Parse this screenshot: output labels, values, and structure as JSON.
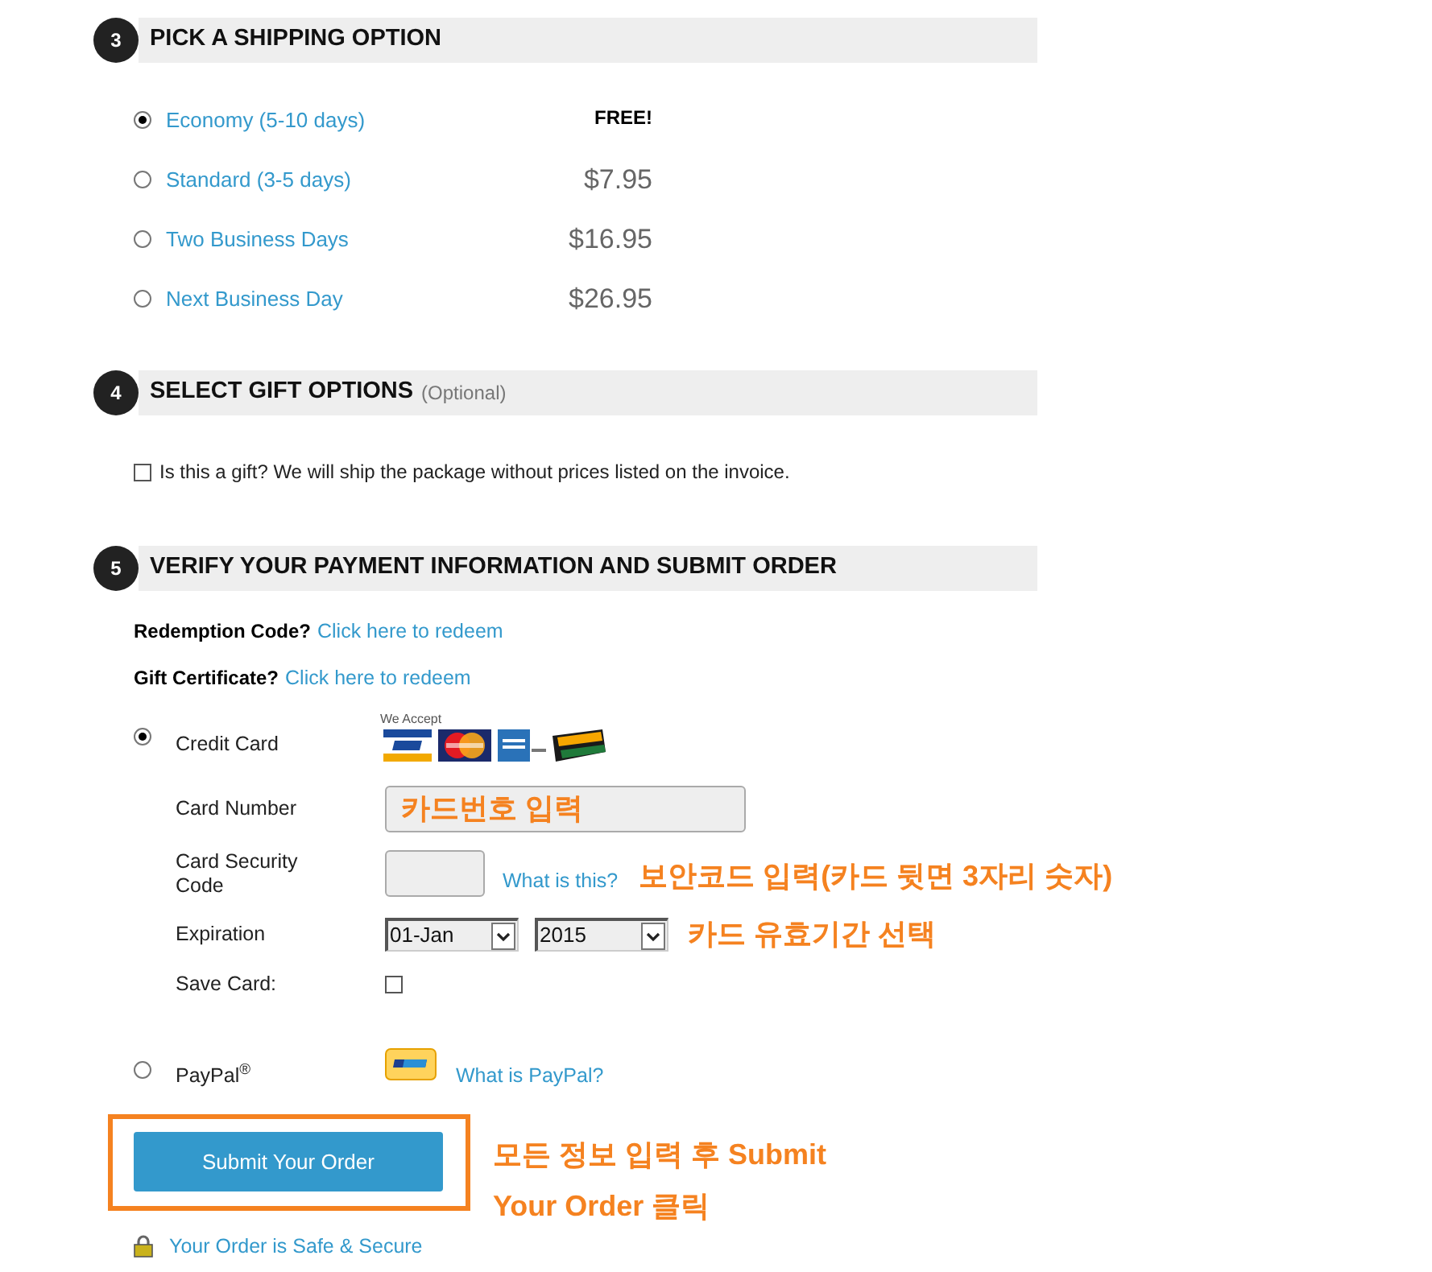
{
  "shipping_section": {
    "number": "3",
    "title": "PICK A SHIPPING OPTION",
    "options": [
      {
        "label": "Economy (5-10 days)",
        "price": "FREE!",
        "kind": "free",
        "selected": true
      },
      {
        "label": "Standard (3-5 days)",
        "price": "$7.95",
        "kind": "paid",
        "selected": false
      },
      {
        "label": "Two Business Days",
        "price": "$16.95",
        "kind": "paid",
        "selected": false
      },
      {
        "label": "Next Business Day",
        "price": "$26.95",
        "kind": "paid",
        "selected": false
      }
    ]
  },
  "gift_section": {
    "number": "4",
    "title": "SELECT GIFT OPTIONS",
    "note": "(Optional)",
    "gift_option": {
      "label": "Is this a gift? We will ship the package without prices listed on the invoice.",
      "checked": false
    }
  },
  "payment_section": {
    "number": "5",
    "title": "VERIFY YOUR PAYMENT INFORMATION AND SUBMIT ORDER",
    "codes": [
      {
        "label": "Redemption Code?",
        "link": "Click here to redeem"
      },
      {
        "label": "Gift Certificate?",
        "link": "Click here to redeem"
      }
    ],
    "methods": [
      {
        "kind": "card",
        "label": "Credit Card",
        "selected": true,
        "accept_label": "We Accept",
        "card_number": {
          "label": "Card Number",
          "annotation": "카드번호 입력"
        },
        "security_code": {
          "label": "Card Security Code",
          "link": "What is this?",
          "annotation": "보안코드 입력(카드 뒷면 3자리 숫자)"
        },
        "expiration": {
          "label": "Expiration",
          "month": "01-Jan",
          "year": "2015",
          "annotation": "카드 유효기간 선택"
        },
        "save_card": {
          "label": "Save Card:",
          "checked": false
        }
      },
      {
        "kind": "paypal",
        "label": "PayPal$^{®}$",
        "selected": false,
        "link": "What is PayPal?"
      }
    ],
    "submit": {
      "label": "Submit Your Order",
      "annotation_lines": [
        "모든 정보 입력 후 Submit",
        "Your Order 클릭"
      ]
    },
    "secure_note": "Your Order is Safe & Secure"
  }
}
